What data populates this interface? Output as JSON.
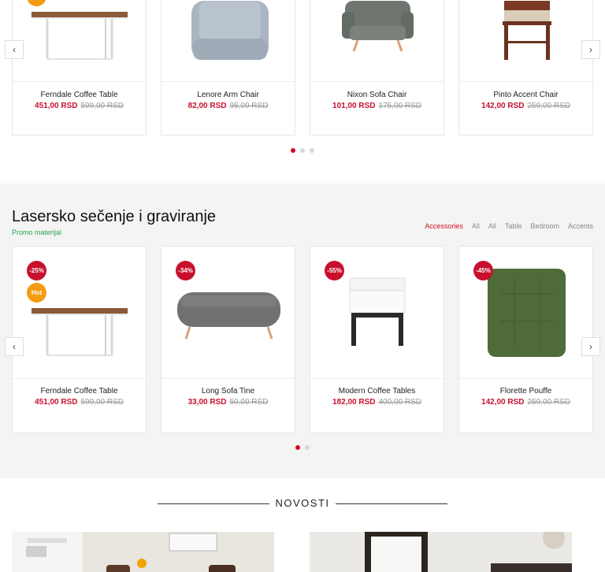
{
  "top_carousel": {
    "products": [
      {
        "name": "Ferndale Coffee Table",
        "price": "451,00 RSD",
        "old_price": "599,00 RSD"
      },
      {
        "name": "Lenore Arm Chair",
        "price": "82,00 RSD",
        "old_price": "95,00 RSD"
      },
      {
        "name": "Nixon Sofa Chair",
        "price": "101,00 RSD",
        "old_price": "175,00 RSD"
      },
      {
        "name": "Pinto Accent Chair",
        "price": "142,00 RSD",
        "old_price": "259,00 RSD"
      }
    ],
    "prev_icon": "‹",
    "next_icon": "›"
  },
  "laser_section": {
    "title": "Lasersko sečenje i graviranje",
    "subtitle": "Promo materijal",
    "filters": [
      "Accessories",
      "All",
      "All",
      "Table",
      "Bedroom",
      "Accents"
    ],
    "active_filter": "Accessories",
    "products": [
      {
        "name": "Ferndale Coffee Table",
        "price": "451,00 RSD",
        "old_price": "599,00 RSD",
        "discount": "-25%",
        "hot": "Hot"
      },
      {
        "name": "Long Sofa Tine",
        "price": "33,00 RSD",
        "old_price": "50,00 RSD",
        "discount": "-34%"
      },
      {
        "name": "Modern Coffee Tables",
        "price": "182,00 RSD",
        "old_price": "400,00 RSD",
        "discount": "-55%"
      },
      {
        "name": "Florette Pouffe",
        "price": "142,00 RSD",
        "old_price": "259,00 RSD",
        "discount": "-45%"
      }
    ],
    "prev_icon": "‹",
    "next_icon": "›"
  },
  "news": {
    "title": "NOVOSTI"
  },
  "colors": {
    "accent": "#c8102e",
    "hot": "#f39c12",
    "green": "#2aa34a"
  }
}
